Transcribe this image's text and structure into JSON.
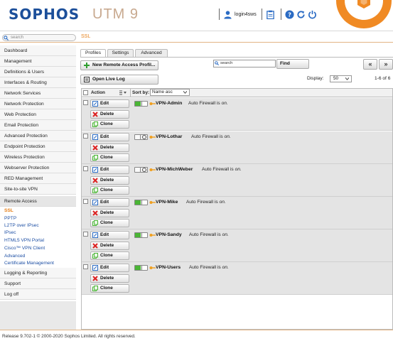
{
  "header": {
    "logo": "SOPHOS",
    "product": "UTM 9",
    "user": "login4sws",
    "colors": {
      "brand": "#1c4f9a",
      "accent": "#f08a24"
    },
    "icons": [
      "user-icon",
      "clipboard-icon",
      "help-icon",
      "reload-icon",
      "power-icon"
    ]
  },
  "subheader": {
    "search_placeholder": "search",
    "breadcrumb": "SSL"
  },
  "sidebar": {
    "items": [
      "Dashboard",
      "Management",
      "Definitions & Users",
      "Interfaces & Routing",
      "Network Services",
      "Network Protection",
      "Web Protection",
      "Email Protection",
      "Advanced Protection",
      "Endpoint Protection",
      "Wireless Protection",
      "Webserver Protection",
      "RED Management",
      "Site-to-site VPN",
      "Remote Access"
    ],
    "remote_access_sub": [
      "SSL",
      "PPTP",
      "L2TP over IPsec",
      "IPsec",
      "HTML5 VPN Portal",
      "Cisco™ VPN Client",
      "Advanced",
      "Certificate Management"
    ],
    "bottom_items": [
      "Logging & Reporting",
      "Support",
      "Log off"
    ]
  },
  "tabs": [
    "Profiles",
    "Settings",
    "Advanced"
  ],
  "toolbar": {
    "new_button": "New Remote Access Profil...",
    "live_log_button": "Open Live Log",
    "search_value": "search",
    "find_button": "Find",
    "prev_page": "«",
    "next_page": "»",
    "display_label": "Display:",
    "display_value": "50",
    "range": "1-6 of 6"
  },
  "table": {
    "col_action": "Action",
    "col_sortby": "Sort by:",
    "sort_value": "Name asc",
    "edit_label": "Edit",
    "delete_label": "Delete",
    "clone_label": "Clone",
    "firewall_prefix": "Auto Firewall is",
    "firewall_state": "on.",
    "rows": [
      {
        "name": "VPN-Admin",
        "enabled": true
      },
      {
        "name": "VPN-Lothar",
        "enabled": false
      },
      {
        "name": "VPN-MichWeber",
        "enabled": false
      },
      {
        "name": "VPN-Mike",
        "enabled": true
      },
      {
        "name": "VPN-Sandy",
        "enabled": true
      },
      {
        "name": "VPN-Users",
        "enabled": true
      }
    ]
  },
  "footer": "Release 9.702-1  © 2000-2020 Sophos Limited. All rights reserved."
}
